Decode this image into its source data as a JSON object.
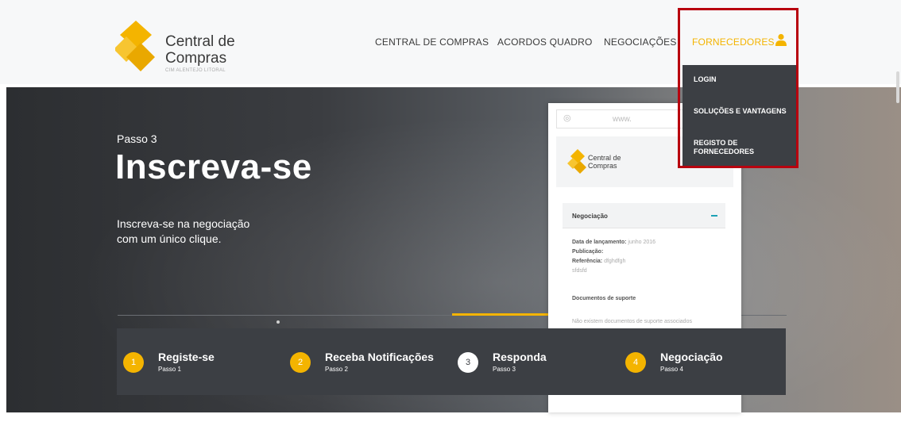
{
  "header": {
    "logo_line1": "Central de",
    "logo_line2": "Compras",
    "logo_sub": "CIM ALENTEJO LITORAL",
    "nav": [
      {
        "label": "CENTRAL DE COMPRAS"
      },
      {
        "label": "ACORDOS QUADRO"
      },
      {
        "label": "NEGOCIAÇÕES"
      },
      {
        "label": "FORNECEDORES"
      }
    ]
  },
  "dropdown": {
    "items": [
      {
        "label": "LOGIN"
      },
      {
        "label": "SOLUÇÕES E VANTAGENS"
      },
      {
        "label_line1": "REGISTO DE",
        "label_line2": "FORNECEDORES"
      }
    ]
  },
  "hero": {
    "step_label": "Passo 3",
    "title": "Inscreva-se",
    "desc_line1": "Inscreva-se na negociação",
    "desc_line2": "com um único clique."
  },
  "mockup": {
    "address": "www.",
    "logo_line1": "Central de",
    "logo_line2": "Compras",
    "panel_title": "Negociação",
    "lines": [
      {
        "key": "Data de lançamento:",
        "val": " junho 2016"
      },
      {
        "key": "Publicação:",
        "val": ""
      },
      {
        "key": "Referência:",
        "val": " dfghdfgh"
      },
      {
        "key": "",
        "val": "sfdsfd"
      }
    ],
    "docs_title": "Documentos de suporte",
    "docs_empty": "Não existem documentos de suporte associados"
  },
  "steps": [
    {
      "num": "1",
      "name": "Registe-se",
      "sub": "Passo 1"
    },
    {
      "num": "2",
      "name": "Receba Notificações",
      "sub": "Passo 2"
    },
    {
      "num": "3",
      "name": "Responda",
      "sub": "Passo 3"
    },
    {
      "num": "4",
      "name": "Negociação",
      "sub": "Passo 4"
    }
  ],
  "colors": {
    "accent": "#f4b400",
    "dark": "#3c3f44",
    "highlight": "#b8000e"
  }
}
